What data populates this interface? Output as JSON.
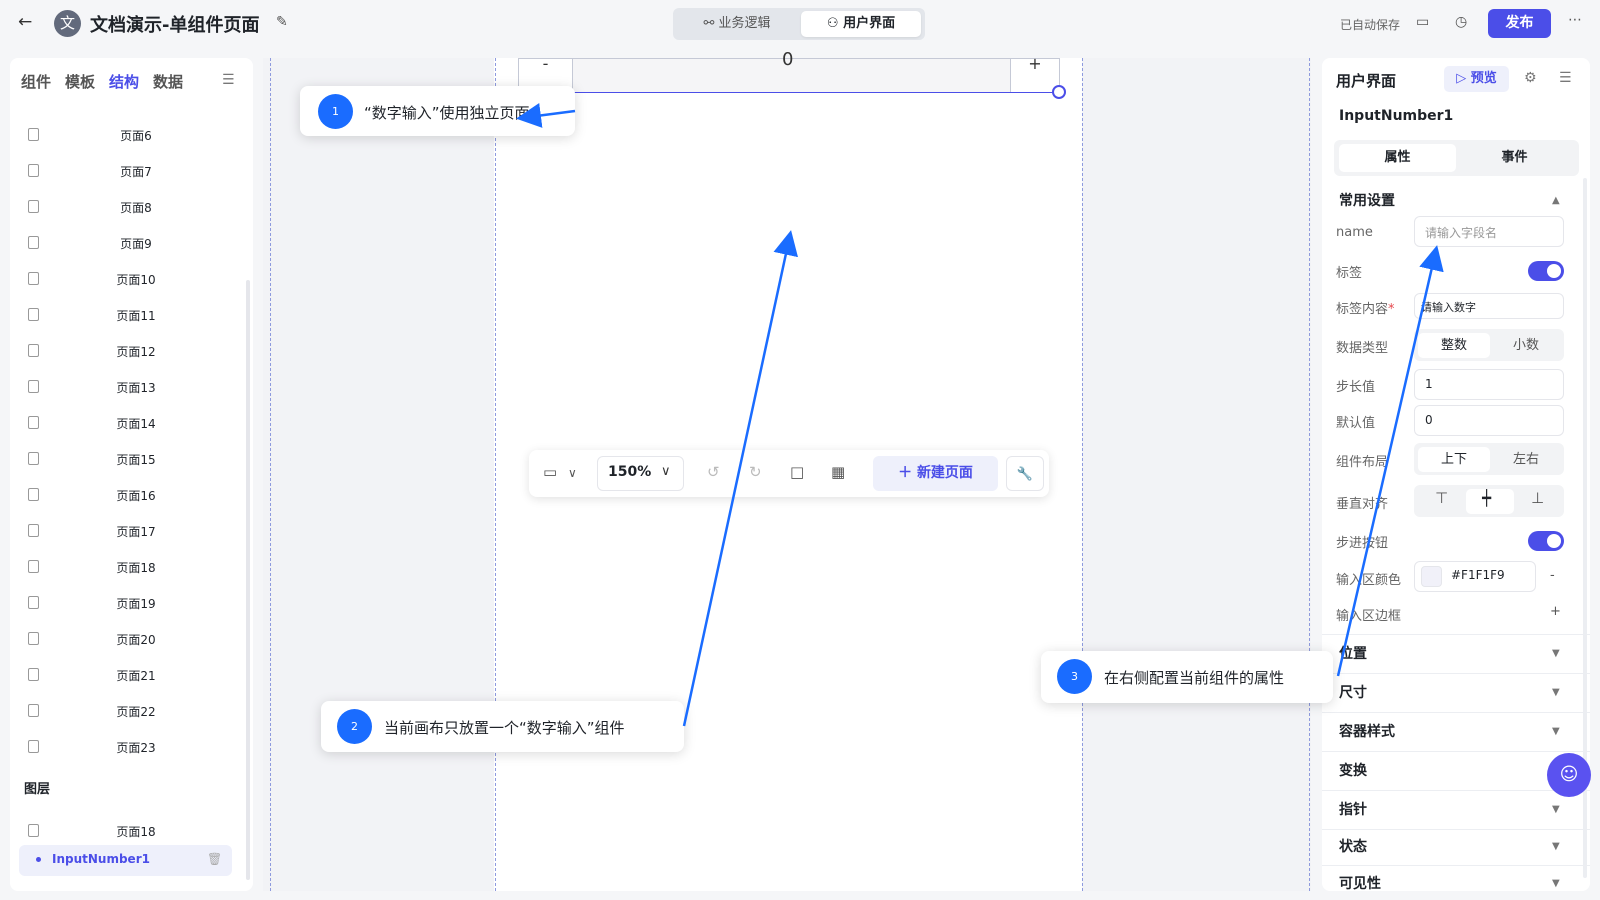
{
  "header": {
    "back_icon": "arrow-left-icon",
    "avatar_char": "文",
    "title": "文档演示-单组件页面",
    "tabs": [
      "业务逻辑",
      "用户界面"
    ],
    "autosave": "已自动保存",
    "publish": "发布"
  },
  "left_panel": {
    "tabs": [
      "组件",
      "模板",
      "结构",
      "数据"
    ],
    "active_tab": "结构",
    "pages": [
      "页面6",
      "页面7",
      "页面8",
      "页面9",
      "页面10",
      "页面11",
      "页面12",
      "页面13",
      "页面14",
      "页面15",
      "页面16",
      "页面17",
      "页面18",
      "页面19",
      "页面20",
      "页面21",
      "页面22",
      "页面23"
    ],
    "layers_title": "图层",
    "layer_page": "页面18",
    "layer_component": "InputNumber1"
  },
  "canvas": {
    "input_minus": "-",
    "input_plus": "+",
    "input_value": "0"
  },
  "toolbar": {
    "zoom": "150%",
    "new_page": "新建页面"
  },
  "callouts": [
    {
      "num": "1",
      "text": "“数字输入”使用独立页面"
    },
    {
      "num": "2",
      "text": "当前画布只放置一个“数字输入”组件"
    },
    {
      "num": "3",
      "text": "在右侧配置当前组件的属性"
    }
  ],
  "right_panel": {
    "title": "用户界面",
    "preview": "预览",
    "component": "InputNumber1",
    "tabs": [
      "属性",
      "事件"
    ],
    "section_common": "常用设置",
    "fields": {
      "name_label": "name",
      "name_placeholder": "请输入字段名",
      "label_label": "标签",
      "label_content_label": "标签内容",
      "required_mark": "*",
      "label_content_value": "请输入数字",
      "data_type_label": "数据类型",
      "data_type_options": [
        "整数",
        "小数"
      ],
      "step_label": "步长值",
      "step_value": "1",
      "default_label": "默认值",
      "default_value": "0",
      "layout_label": "组件布局",
      "layout_options": [
        "上下",
        "左右"
      ],
      "valign_label": "垂直对齐",
      "stepper_label": "步进按钮",
      "input_color_label": "输入区颜色",
      "input_color_value": "#F1F1F9",
      "input_border_label": "输入区边框"
    },
    "sections": [
      "位置",
      "尺寸",
      "容器样式",
      "变换",
      "指针",
      "状态",
      "可见性"
    ]
  },
  "colors": {
    "accent": "#4b4ee8",
    "callout_blue": "#1a6cff"
  }
}
